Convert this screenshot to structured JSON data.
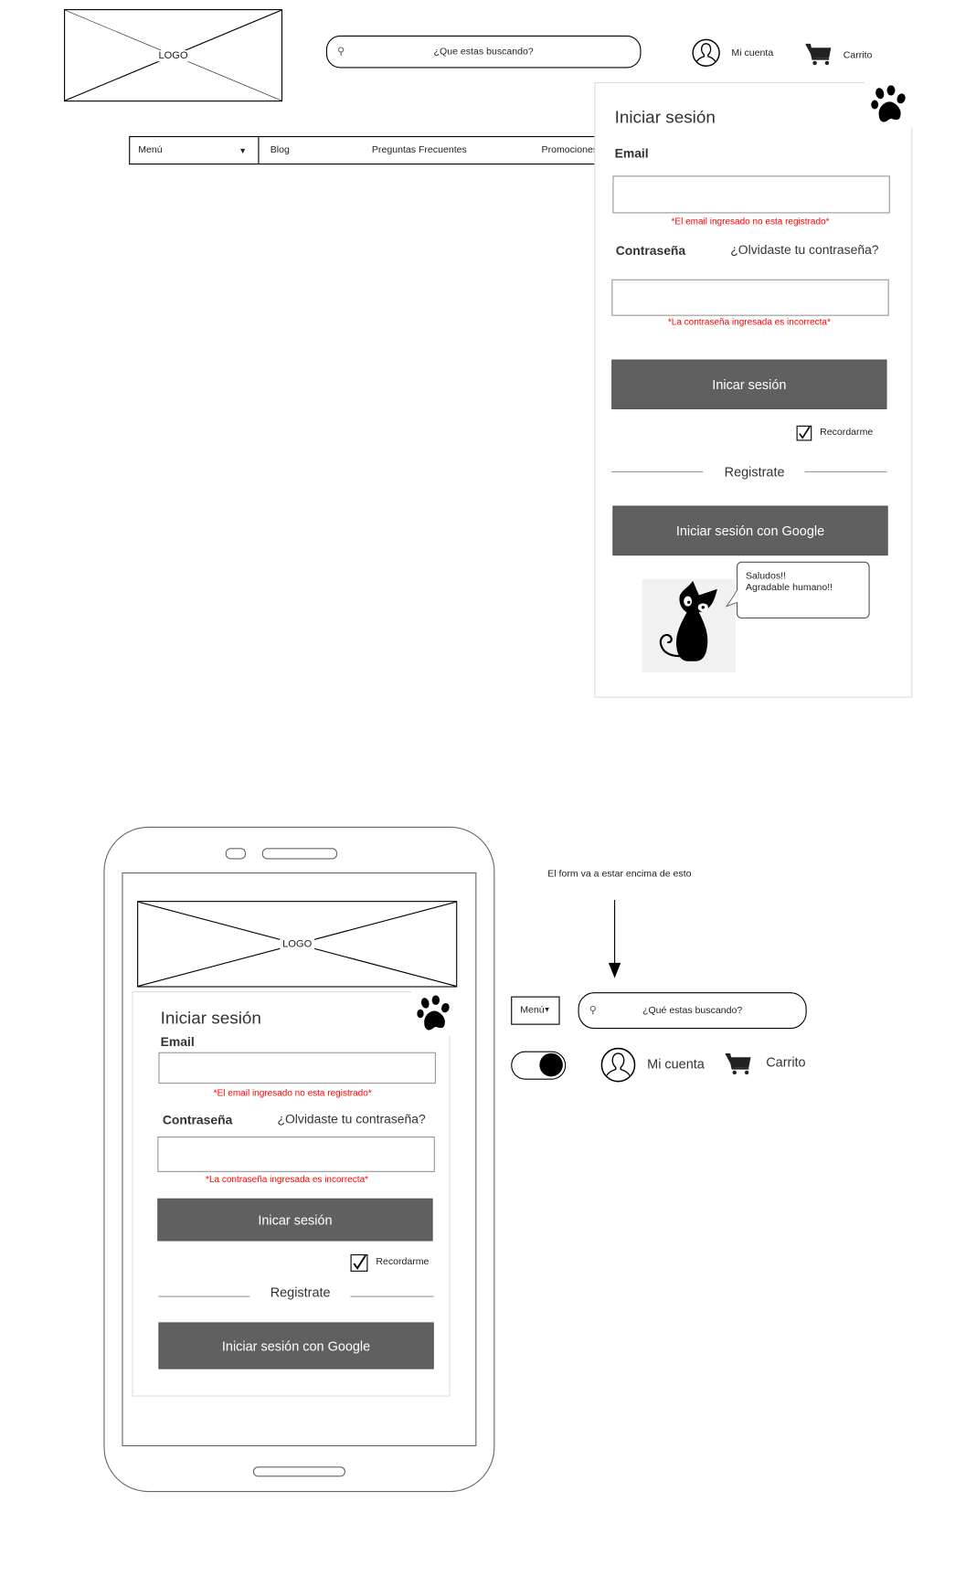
{
  "header": {
    "logo_label": "LOGO",
    "search_placeholder": "¿Que estas buscando?",
    "account_label": "Mi cuenta",
    "cart_label": "Carrito"
  },
  "nav": {
    "menu_label": "Menú",
    "items": [
      "Blog",
      "Preguntas Frecuentes",
      "Promociones"
    ]
  },
  "login_form": {
    "title": "Iniciar sesión",
    "email_label": "Email",
    "email_value": "",
    "email_error": "*El email ingresado no esta registrado*",
    "password_label": "Contraseña",
    "forgot_link": "¿Olvidaste tu contraseña?",
    "password_value": "",
    "password_error": "*La contraseña ingresada es incorrecta*",
    "submit_label": "Inicar sesión",
    "remember_label": "Recordarme",
    "remember_checked": true,
    "register_label": "Registrate",
    "google_label": "Iniciar sesión con Google"
  },
  "mascot": {
    "speech_line1": "Saludos!!",
    "speech_line2": "Agradable humano!!"
  },
  "mobile": {
    "logo_label": "LOGO"
  },
  "annotation": {
    "note": "El form va a estar encima de esto"
  },
  "mobile_header": {
    "menu_label": "Menú",
    "search_placeholder": "¿Qué estas buscando?",
    "account_label": "Mi cuenta",
    "cart_label": "Carrito",
    "toggle_on": true
  }
}
